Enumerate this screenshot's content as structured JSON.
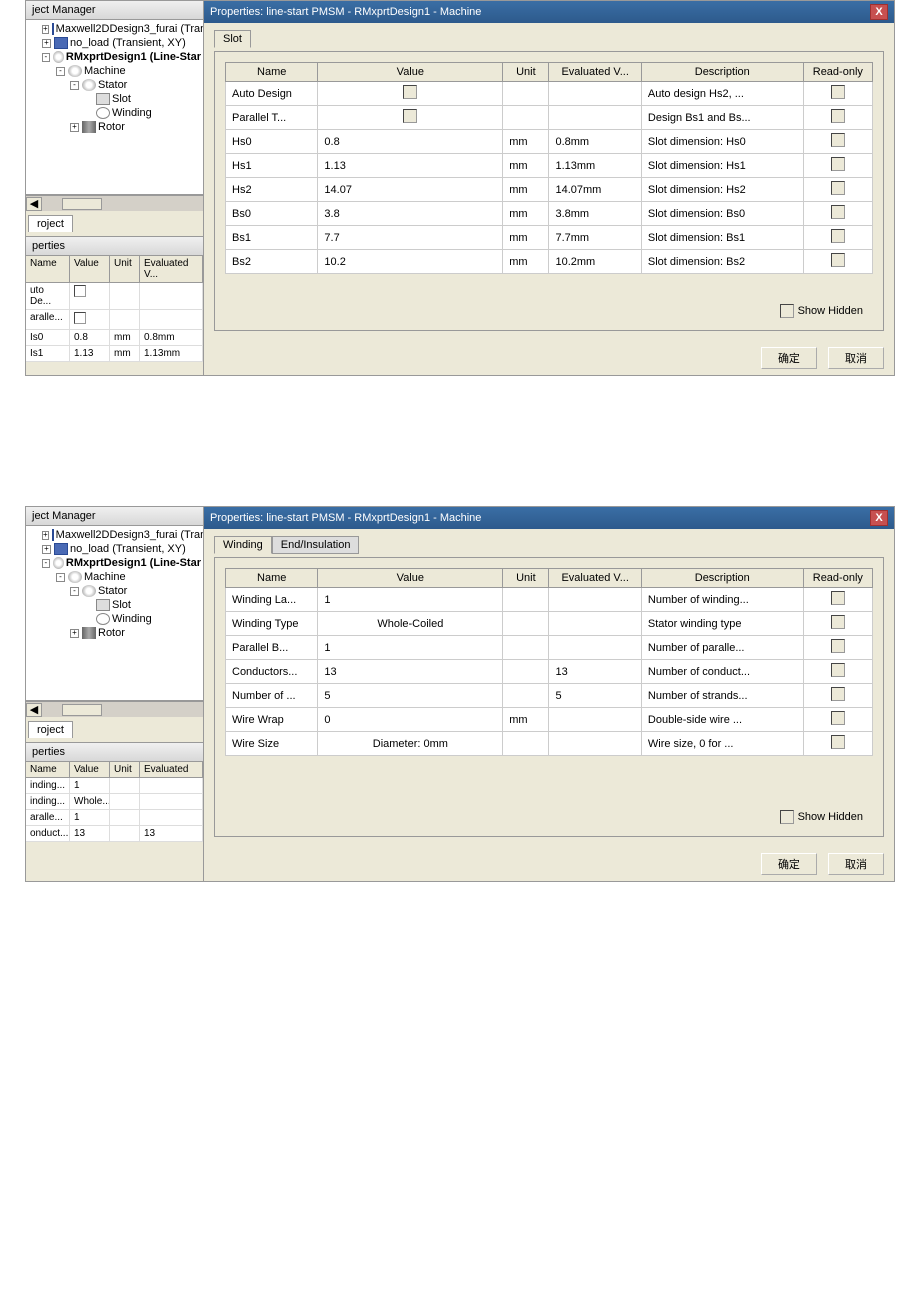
{
  "panel1": {
    "left_title": "ject Manager",
    "properties_label": "perties",
    "project_tab": "roject",
    "tree": {
      "n1": "Maxwell2DDesign3_furai (Tran",
      "n2": "no_load (Transient, XY)",
      "n3": "RMxprtDesign1 (Line-Star",
      "n4": "Machine",
      "n5": "Stator",
      "n6": "Slot",
      "n7": "Winding",
      "n8": "Rotor"
    },
    "mini_headers": {
      "c1": "Name",
      "c2": "Value",
      "c3": "Unit",
      "c4": "Evaluated V..."
    },
    "mini_rows": [
      {
        "c1": "uto De...",
        "c2": "",
        "c3": "",
        "c4": "",
        "chk": true
      },
      {
        "c1": "aralle...",
        "c2": "",
        "c3": "",
        "c4": "",
        "chk": true
      },
      {
        "c1": "Is0",
        "c2": "0.8",
        "c3": "mm",
        "c4": "0.8mm"
      },
      {
        "c1": "Is1",
        "c2": "1.13",
        "c3": "mm",
        "c4": "1.13mm"
      }
    ],
    "titlebar": "Properties: line-start PMSM - RMxprtDesign1 - Machine",
    "tab_label": "Slot",
    "headers": {
      "name": "Name",
      "value": "Value",
      "unit": "Unit",
      "eval": "Evaluated V...",
      "desc": "Description",
      "ro": "Read-only"
    },
    "rows": [
      {
        "name": "Auto Design",
        "value": "",
        "unit": "",
        "eval": "",
        "desc": "Auto design Hs2, ...",
        "chk_value": true
      },
      {
        "name": "Parallel T...",
        "value": "",
        "unit": "",
        "eval": "",
        "desc": "Design Bs1 and Bs...",
        "chk_value": true
      },
      {
        "name": "Hs0",
        "value": "0.8",
        "unit": "mm",
        "eval": "0.8mm",
        "desc": "Slot dimension: Hs0"
      },
      {
        "name": "Hs1",
        "value": "1.13",
        "unit": "mm",
        "eval": "1.13mm",
        "desc": "Slot dimension: Hs1"
      },
      {
        "name": "Hs2",
        "value": "14.07",
        "unit": "mm",
        "eval": "14.07mm",
        "desc": "Slot dimension: Hs2"
      },
      {
        "name": "Bs0",
        "value": "3.8",
        "unit": "mm",
        "eval": "3.8mm",
        "desc": "Slot dimension: Bs0"
      },
      {
        "name": "Bs1",
        "value": "7.7",
        "unit": "mm",
        "eval": "7.7mm",
        "desc": "Slot dimension: Bs1"
      },
      {
        "name": "Bs2",
        "value": "10.2",
        "unit": "mm",
        "eval": "10.2mm",
        "desc": "Slot dimension: Bs2"
      }
    ],
    "show_hidden": "Show Hidden",
    "btn_ok": "确定",
    "btn_cancel": "取消"
  },
  "panel2": {
    "left_title": "ject Manager",
    "properties_label": "perties",
    "project_tab": "roject",
    "tree": {
      "n1": "Maxwell2DDesign3_furai (Tran",
      "n2": "no_load (Transient, XY)",
      "n3": "RMxprtDesign1 (Line-Star",
      "n4": "Machine",
      "n5": "Stator",
      "n6": "Slot",
      "n7": "Winding",
      "n8": "Rotor"
    },
    "mini_headers": {
      "c1": "Name",
      "c2": "Value",
      "c3": "Unit",
      "c4": "Evaluated"
    },
    "mini_rows": [
      {
        "c1": "inding...",
        "c2": "1",
        "c3": "",
        "c4": ""
      },
      {
        "c1": "inding...",
        "c2": "Whole...",
        "c3": "",
        "c4": ""
      },
      {
        "c1": "aralle...",
        "c2": "1",
        "c3": "",
        "c4": ""
      },
      {
        "c1": "onduct...",
        "c2": "13",
        "c3": "",
        "c4": "13"
      }
    ],
    "titlebar": "Properties: line-start PMSM - RMxprtDesign1 - Machine",
    "tab1_label": "Winding",
    "tab2_label": "End/Insulation",
    "headers": {
      "name": "Name",
      "value": "Value",
      "unit": "Unit",
      "eval": "Evaluated V...",
      "desc": "Description",
      "ro": "Read-only"
    },
    "rows": [
      {
        "name": "Winding La...",
        "value": "1",
        "unit": "",
        "eval": "",
        "desc": "Number of winding..."
      },
      {
        "name": "Winding Type",
        "value": "Whole-Coiled",
        "unit": "",
        "eval": "",
        "desc": "Stator winding type",
        "center": true
      },
      {
        "name": "Parallel B...",
        "value": "1",
        "unit": "",
        "eval": "",
        "desc": "Number of paralle..."
      },
      {
        "name": "Conductors...",
        "value": "13",
        "unit": "",
        "eval": "13",
        "desc": "Number of conduct..."
      },
      {
        "name": "Number of ...",
        "value": "5",
        "unit": "",
        "eval": "5",
        "desc": "Number of strands..."
      },
      {
        "name": "Wire Wrap",
        "value": "0",
        "unit": "mm",
        "eval": "",
        "desc": "Double-side wire ..."
      },
      {
        "name": "Wire Size",
        "value": "Diameter: 0mm",
        "unit": "",
        "eval": "",
        "desc": "Wire size, 0 for ...",
        "center": true
      }
    ],
    "show_hidden": "Show Hidden",
    "btn_ok": "确定",
    "btn_cancel": "取消"
  }
}
